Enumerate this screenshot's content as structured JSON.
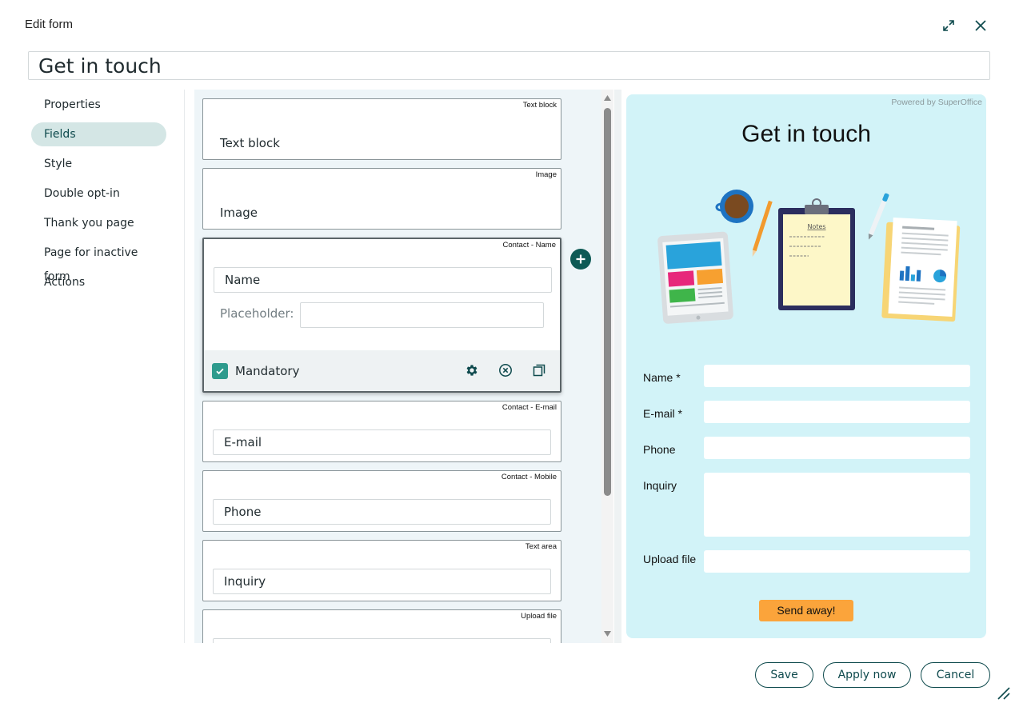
{
  "dialog": {
    "title": "Edit form"
  },
  "form_name": {
    "value": "Get in touch"
  },
  "sidebar": {
    "items": [
      {
        "label": "Properties"
      },
      {
        "label": "Fields",
        "active": true
      },
      {
        "label": "Style"
      },
      {
        "label": "Double opt-in"
      },
      {
        "label": "Thank you page"
      },
      {
        "label": "Page for inactive form"
      },
      {
        "label": "Actions"
      }
    ]
  },
  "fields": [
    {
      "type": "Text block",
      "label": "Text block"
    },
    {
      "type": "Image",
      "label": "Image"
    },
    {
      "type": "Contact - Name",
      "label": "Name",
      "placeholder_label": "Placeholder:",
      "placeholder_value": "",
      "mandatory_label": "Mandatory",
      "mandatory": true
    },
    {
      "type": "Contact - E-mail",
      "label": "E-mail"
    },
    {
      "type": "Contact - Mobile",
      "label": "Phone"
    },
    {
      "type": "Text area",
      "label": "Inquiry"
    },
    {
      "type": "Upload file",
      "label": ""
    }
  ],
  "icons": {
    "expand": "expand-icon",
    "close": "close-icon",
    "add": "plus-circle-icon",
    "settings": "gear-icon",
    "remove": "circle-x-icon",
    "duplicate": "copy-icon",
    "check": "check-icon",
    "resize": "resize-grip-icon"
  },
  "preview": {
    "powered_by": "Powered by SuperOffice",
    "title": "Get in touch",
    "notes_heading": "Notes",
    "fields": [
      {
        "label": "Name *"
      },
      {
        "label": "E-mail *"
      },
      {
        "label": "Phone"
      },
      {
        "label": "Inquiry"
      },
      {
        "label": "Upload file"
      }
    ],
    "submit_label": "Send away!"
  },
  "footer": {
    "save": "Save",
    "apply": "Apply now",
    "cancel": "Cancel"
  },
  "colors": {
    "accent": "#0e4a4d",
    "active_nav_bg": "#d4e6e5",
    "checkbox": "#2e9b8d",
    "preview_bg": "#d2f3f8",
    "submit_bg": "#fba43b"
  }
}
